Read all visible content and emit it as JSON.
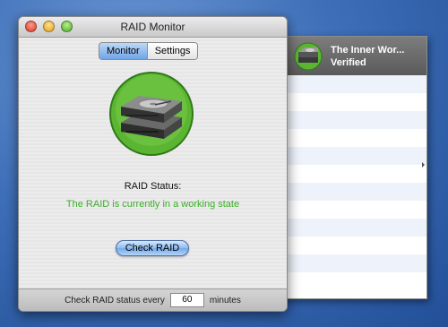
{
  "window": {
    "title": "RAID Monitor"
  },
  "tabs": [
    {
      "label": "Monitor",
      "selected": true
    },
    {
      "label": "Settings",
      "selected": false
    }
  ],
  "status": {
    "label": "RAID Status:",
    "message": "The RAID is currently in a working state",
    "message_color": "#3cae2a"
  },
  "actions": {
    "check_label": "Check RAID"
  },
  "footer": {
    "prefix": "Check RAID status every",
    "interval_value": "60",
    "suffix": "minutes"
  },
  "drawer": {
    "items": [
      {
        "name": "The Inner Wor...",
        "status": "Verified",
        "icon": "hard-drive-icon"
      }
    ]
  },
  "colors": {
    "accent": "#6ea4e6",
    "hero_green": "#5bb533",
    "selection_gray": "#6b6b6b"
  }
}
